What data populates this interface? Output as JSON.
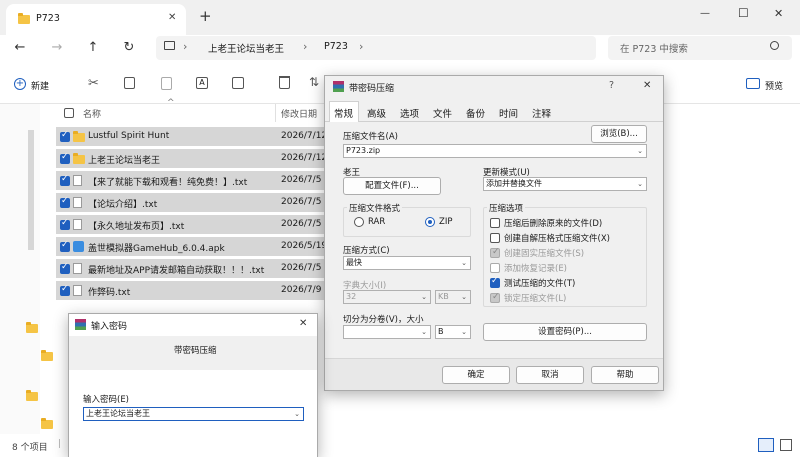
{
  "window": {
    "tab_title": "P723",
    "new_tab": "+",
    "minimize": "—",
    "maximize": "☐",
    "close": "✕"
  },
  "nav": {
    "back": "←",
    "forward": "→",
    "up": "↑",
    "refresh": "↻",
    "sep": "›",
    "breadcrumb": [
      "上老王论坛当老王",
      "P723"
    ],
    "search_placeholder": "在 P723 中搜索"
  },
  "toolbar": {
    "new_label": "新建",
    "view_label": "预览",
    "more": "⇅"
  },
  "file_list": {
    "col_name": "名称",
    "col_date": "修改日期",
    "sort_arrow": "^",
    "files": [
      {
        "name": "Lustful Spirit Hunt",
        "date": "2026/7/12",
        "type": "folder"
      },
      {
        "name": "上老王论坛当老王",
        "date": "2026/7/12",
        "type": "folder"
      },
      {
        "name": "【来了就能下载和观看！纯免费！】.txt",
        "date": "2026/7/5",
        "type": "txt"
      },
      {
        "name": "【论坛介绍】.txt",
        "date": "2026/7/5",
        "type": "txt"
      },
      {
        "name": "【永久地址发布页】.txt",
        "date": "2026/7/5",
        "type": "txt"
      },
      {
        "name": "盖世模拟器GameHub_6.0.4.apk",
        "date": "2026/5/19",
        "type": "apk"
      },
      {
        "name": "最新地址及APP请发邮箱自动获取！！！.txt",
        "date": "2026/7/5",
        "type": "txt"
      },
      {
        "name": "作弊码.txt",
        "date": "2026/7/9",
        "type": "txt"
      }
    ]
  },
  "status": {
    "item_count": "8 个项目",
    "sep": "|"
  },
  "rar_dialog": {
    "title": "带密码压缩",
    "help": "?",
    "close": "✕",
    "tabs": [
      "常规",
      "高级",
      "选项",
      "文件",
      "备份",
      "时间",
      "注释"
    ],
    "archive_label": "压缩文件名(A)",
    "archive_value": "P723.zip",
    "browse_button": "浏览(B)...",
    "profile_group": "老王",
    "profile_button": "配置文件(F)...",
    "update_label": "更新模式(U)",
    "update_value": "添加并替换文件",
    "format_group": "压缩文件格式",
    "format_rar": "RAR",
    "format_zip": "ZIP",
    "method_label": "压缩方式(C)",
    "method_value": "最快",
    "dict_label": "字典大小(I)",
    "dict_value": "32",
    "dict_unit": "KB",
    "split_label": "切分为分卷(V)，大小",
    "split_value": "",
    "split_unit": "B",
    "options_group": "压缩选项",
    "options": [
      {
        "label": "压缩后删除原来的文件(D)",
        "state": "off"
      },
      {
        "label": "创建自解压格式压缩文件(X)",
        "state": "off"
      },
      {
        "label": "创建固实压缩文件(S)",
        "state": "dis"
      },
      {
        "label": "添加恢复记录(E)",
        "state": "dis-off"
      },
      {
        "label": "测试压缩的文件(T)",
        "state": "on"
      },
      {
        "label": "锁定压缩文件(L)",
        "state": "dis"
      }
    ],
    "password_button": "设置密码(P)...",
    "ok_button": "确定",
    "cancel_button": "取消",
    "help_button": "帮助"
  },
  "password_dialog": {
    "title": "输入密码",
    "close": "✕",
    "subtitle": "带密码压缩",
    "input_label": "输入密码(E)",
    "input_value": "上老王论坛当老王"
  },
  "colors": {
    "accent": "#1f5fbf",
    "selection": "#d6d6d6",
    "folder": "#f5c445"
  },
  "icons": {
    "winrar": "winrar-icon",
    "folder": "folder-icon",
    "chevron": "⌄"
  }
}
